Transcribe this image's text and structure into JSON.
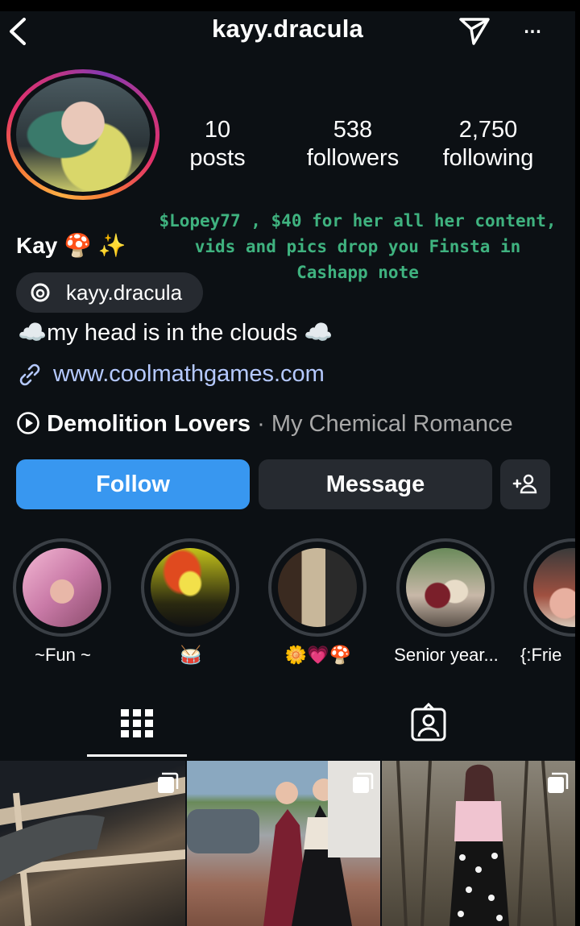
{
  "header": {
    "username": "kayy.dracula",
    "back_icon": "chevron-left-icon",
    "send_icon": "paper-plane-icon",
    "more_icon": "more-horizontal-icon",
    "more_glyph": "..."
  },
  "stats": [
    {
      "value": "10",
      "label": "posts"
    },
    {
      "value": "538",
      "label": "followers"
    },
    {
      "value": "2,750",
      "label": "following"
    }
  ],
  "overlay_text": "$Lopey77 , $40 for her all her content, vids and pics  drop you Finsta in Cashapp note",
  "profile": {
    "name": "Kay 🍄 ✨",
    "threads_handle": "kayy.dracula",
    "bio": "☁️my head is in the clouds ☁️",
    "link": "www.coolmathgames.com",
    "song": "Demolition Lovers",
    "artist": " · My Chemical Romance"
  },
  "buttons": {
    "follow": "Follow",
    "message": "Message",
    "add_user_glyph": "+👤"
  },
  "highlights": [
    {
      "label": "~Fun ~"
    },
    {
      "label": "🥁"
    },
    {
      "label": "🌼💗🍄"
    },
    {
      "label": "Senior year..."
    },
    {
      "label": "{:Frie"
    }
  ],
  "tabs": [
    {
      "name": "grid-tab",
      "icon": "grid-icon",
      "active": true
    },
    {
      "name": "tagged-tab",
      "icon": "tagged-person-icon",
      "active": false
    }
  ],
  "colors": {
    "background": "#0c1014",
    "accent": "#3897f0",
    "link": "#b5c9ff",
    "overlay_text": "#3fb27f",
    "button_dark": "#262a30"
  }
}
